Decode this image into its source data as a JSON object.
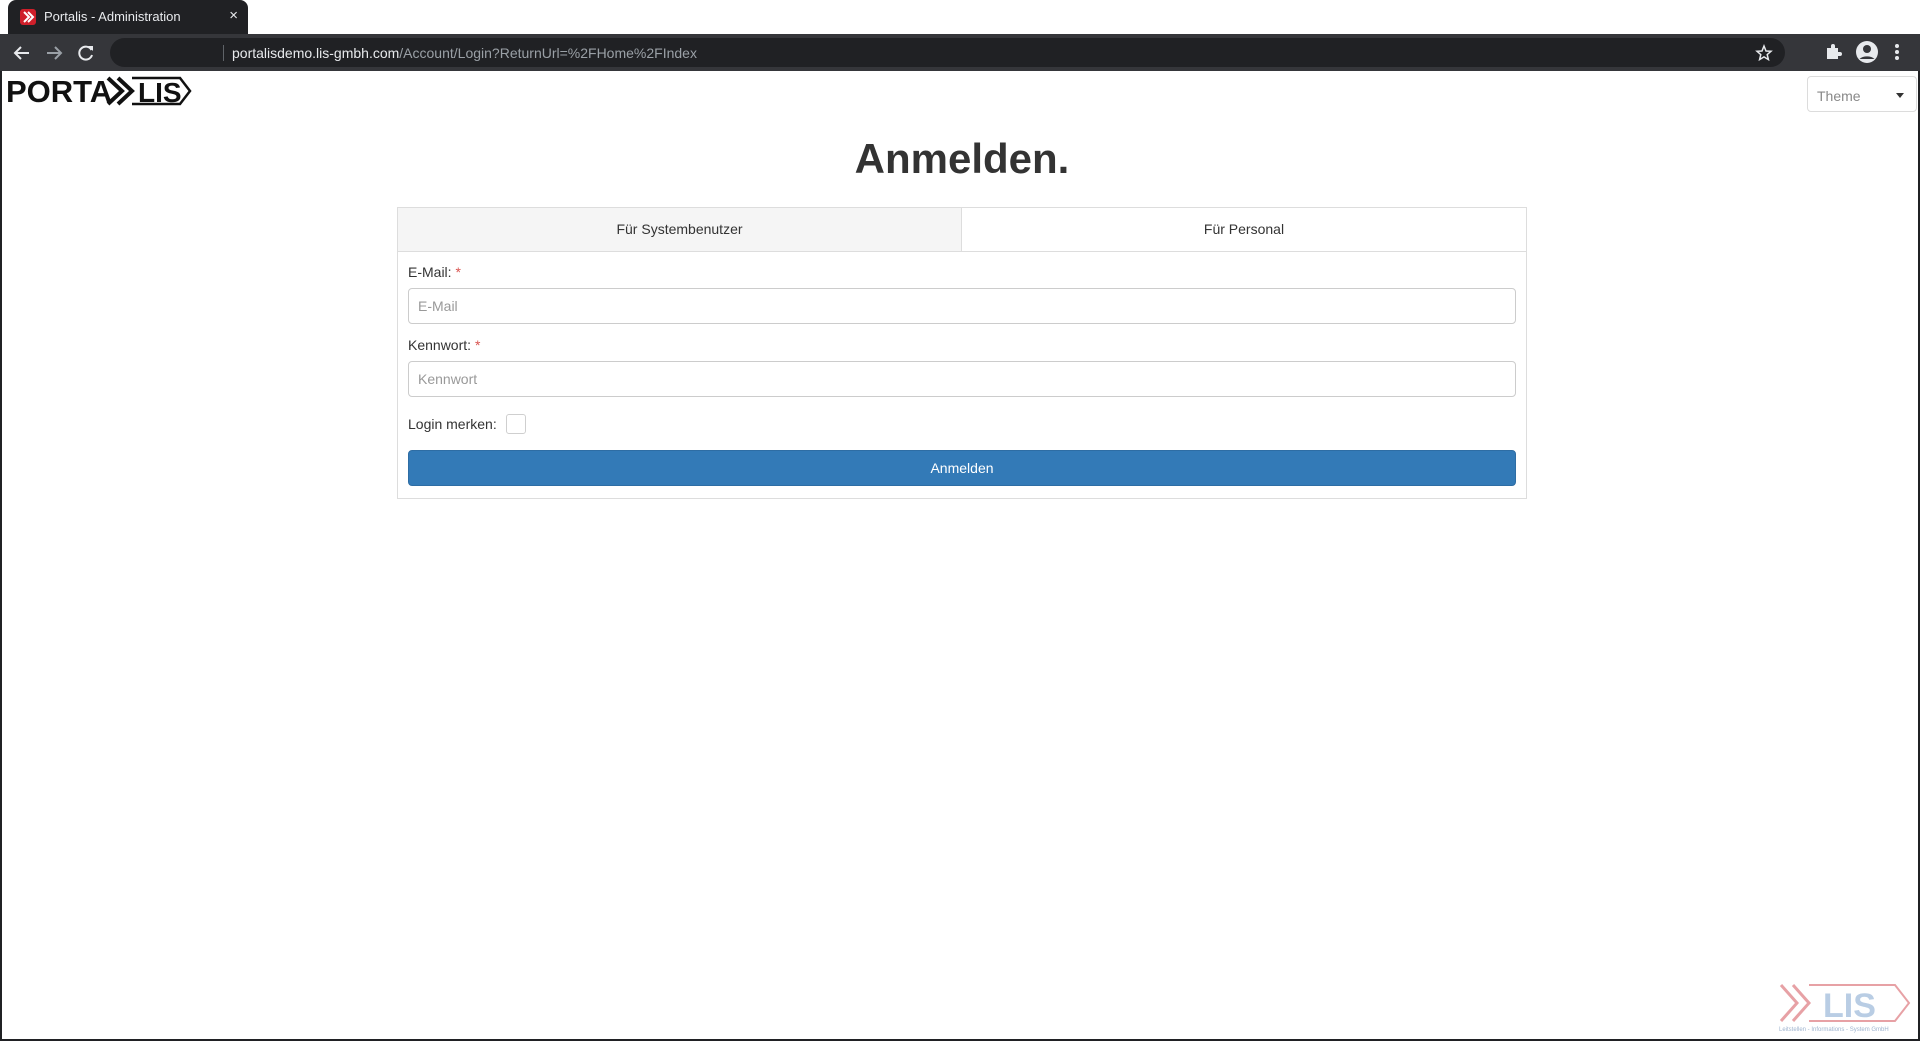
{
  "browser": {
    "tab_title": "Portalis - Administration",
    "tab_close": "×",
    "url_host": "portalisdemo.lis-gmbh.com",
    "url_path": "/Account/Login?ReturnUrl=%2FHome%2FIndex"
  },
  "header": {
    "logo_text": "PORTALIS",
    "theme_label": "Theme"
  },
  "login": {
    "heading": "Anmelden.",
    "tabs": [
      {
        "label": "Für Systembenutzer"
      },
      {
        "label": "Für Personal"
      }
    ],
    "email_label": "E-Mail:",
    "email_placeholder": "E-Mail",
    "password_label": "Kennwort:",
    "password_placeholder": "Kennwort",
    "required_mark": "*",
    "remember_label": "Login merken:",
    "submit_label": "Anmelden"
  },
  "footer": {
    "logo_text": "LIS",
    "logo_subtitle": "Leitstellen - Informations - System GmbH"
  },
  "colors": {
    "primary": "#337ab7",
    "required": "#d9534f",
    "browser_dark": "#202124"
  }
}
